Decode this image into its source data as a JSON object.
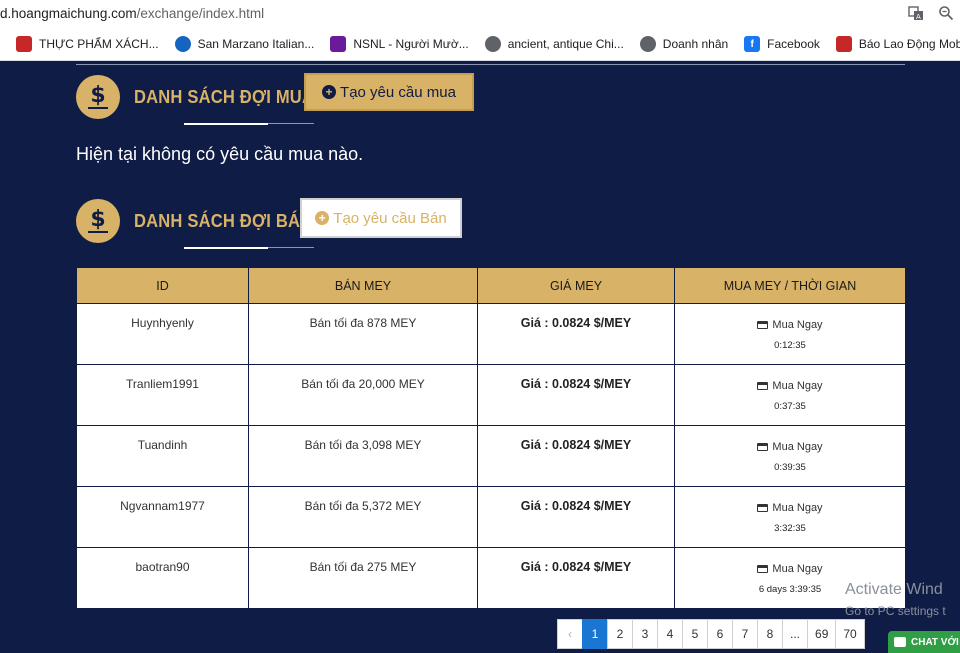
{
  "browser": {
    "url_host": "d.hoangmaichung.com",
    "url_path": "/exchange/index.html",
    "icons": [
      "translate-icon",
      "zoom-icon"
    ],
    "bookmarks": [
      {
        "label": "THỰC PHẨM XÁCH...",
        "icon": "flag-icon",
        "color": "#c62828"
      },
      {
        "label": "San Marzano Italian...",
        "icon": "globe-icon",
        "color": "#1565c0"
      },
      {
        "label": "NSNL - Người Mườ...",
        "icon": "game-icon",
        "color": "#6a1b9a"
      },
      {
        "label": "ancient, antique Chi...",
        "icon": "globe-icon",
        "color": "#5f6368"
      },
      {
        "label": "Doanh nhân",
        "icon": "globe-icon",
        "color": "#5f6368"
      },
      {
        "label": "Facebook",
        "icon": "facebook-icon",
        "color": "#1877f2"
      },
      {
        "label": "Báo Lao Động Mob...",
        "icon": "news-icon",
        "color": "#c62828"
      }
    ]
  },
  "buy_section": {
    "title": "DANH SÁCH ĐỢI MUA",
    "button": "Tạo yêu cầu mua",
    "empty_message": "Hiện tại không có yêu cầu mua nào."
  },
  "sell_section": {
    "title": "DANH SÁCH ĐỢI BÁN",
    "button": "Tạo yêu cầu Bán"
  },
  "table": {
    "headers": [
      "ID",
      "BÁN MEY",
      "GIÁ MEY",
      "MUA MEY / THỜI GIAN"
    ],
    "buy_label": "Mua Ngay",
    "rows": [
      {
        "id": "Huynhyenly",
        "sell": "Bán tối đa 878 MEY",
        "price": "Giá : 0.0824 $/MEY",
        "time": "0:12:35"
      },
      {
        "id": "Tranliem1991",
        "sell": "Bán tối đa 20,000 MEY",
        "price": "Giá : 0.0824 $/MEY",
        "time": "0:37:35"
      },
      {
        "id": "Tuandinh",
        "sell": "Bán tối đa 3,098 MEY",
        "price": "Giá : 0.0824 $/MEY",
        "time": "0:39:35"
      },
      {
        "id": "Ngvannam1977",
        "sell": "Bán tối đa 5,372 MEY",
        "price": "Giá : 0.0824 $/MEY",
        "time": "3:32:35"
      },
      {
        "id": "baotran90",
        "sell": "Bán tối đa 275 MEY",
        "price": "Giá : 0.0824 $/MEY",
        "time": "6 days 3:39:35"
      }
    ]
  },
  "pagination": {
    "prev": "‹",
    "pages": [
      "1",
      "2",
      "3",
      "4",
      "5",
      "6",
      "7",
      "8",
      "...",
      "69",
      "70"
    ],
    "active": "1"
  },
  "overlay": {
    "activate_line1": "Activate Wind",
    "activate_line2": "Go to PC settings t",
    "chat_label": "CHAT VỚI"
  },
  "colors": {
    "background": "#0f1c46",
    "gold": "#d8b266",
    "active_page": "#1976d2",
    "chat": "#2f9e44"
  }
}
